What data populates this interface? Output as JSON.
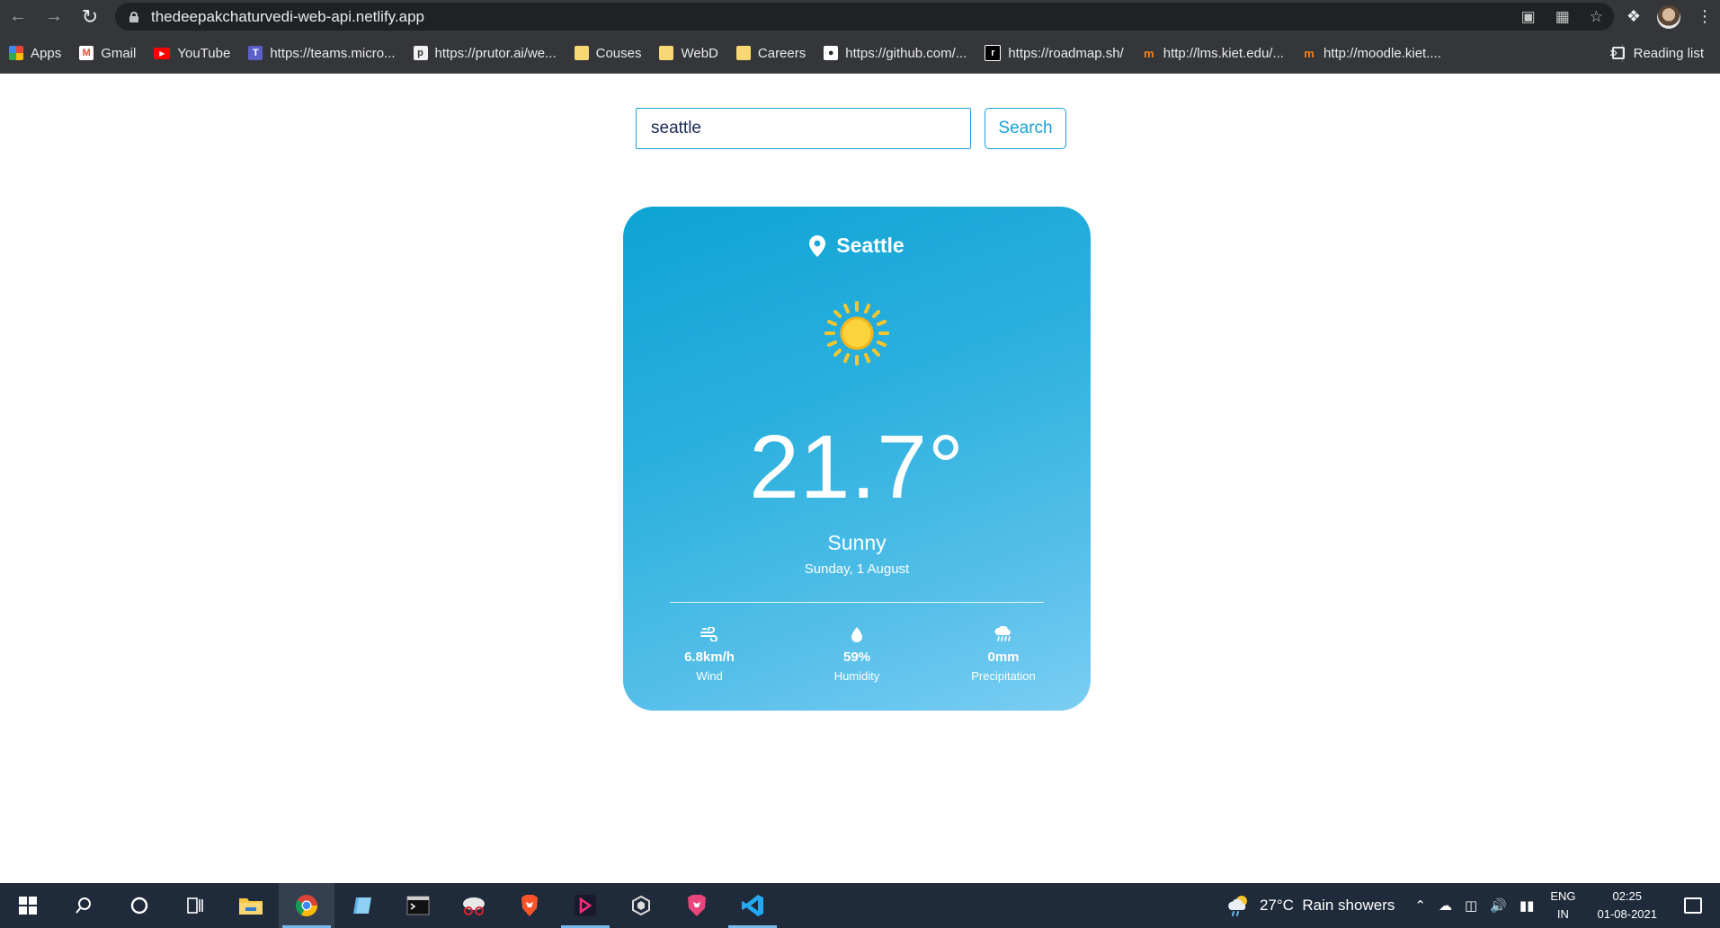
{
  "browser": {
    "url": "thedeepakchaturvedi-web-api.netlify.app",
    "bookmarks": [
      {
        "label": "Apps",
        "icon": "apps-grid-icon"
      },
      {
        "label": "Gmail",
        "icon": "gmail-icon"
      },
      {
        "label": "YouTube",
        "icon": "youtube-icon"
      },
      {
        "label": "https://teams.micro...",
        "icon": "teams-icon"
      },
      {
        "label": "https://prutor.ai/we...",
        "icon": "prutor-icon"
      },
      {
        "label": "Couses",
        "icon": "folder-icon"
      },
      {
        "label": "WebD",
        "icon": "folder-icon"
      },
      {
        "label": "Careers",
        "icon": "folder-icon"
      },
      {
        "label": "https://github.com/...",
        "icon": "github-icon"
      },
      {
        "label": "https://roadmap.sh/",
        "icon": "roadmap-icon"
      },
      {
        "label": "http://lms.kiet.edu/...",
        "icon": "moodle-icon"
      },
      {
        "label": "http://moodle.kiet....",
        "icon": "moodle-icon"
      }
    ],
    "more_label": "»",
    "reading_list": "Reading list"
  },
  "search": {
    "value": "seattle",
    "button_label": "Search"
  },
  "weather": {
    "city": "Seattle",
    "icon": "sun-icon",
    "temperature": "21.7°",
    "condition": "Sunny",
    "date": "Sunday, 1 August",
    "stats": [
      {
        "value": "6.8km/h",
        "label": "Wind",
        "icon": "wind-icon"
      },
      {
        "value": "59%",
        "label": "Humidity",
        "icon": "droplet-icon"
      },
      {
        "value": "0mm",
        "label": "Precipitation",
        "icon": "rain-cloud-icon"
      }
    ]
  },
  "taskbar": {
    "weather": "27°C  Rain showers",
    "lang_line1": "ENG",
    "lang_line2": "IN",
    "time": "02:25",
    "date": "01-08-2021"
  },
  "colors": {
    "accent": "#17a2d8",
    "card_top": "#0ea3d4",
    "card_bottom": "#7bcdf3",
    "chrome_bg": "#35363a",
    "taskbar_bg": "#1f2a3a"
  }
}
